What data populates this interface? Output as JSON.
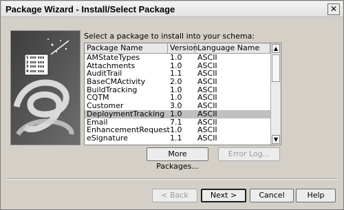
{
  "window": {
    "title": "Package Wizard - Install/Select Package",
    "close_label": "✕"
  },
  "prompt": "Select a package to install into your schema:",
  "list": {
    "columns": [
      "Package Name",
      "Version",
      "Language Name"
    ],
    "rows": [
      [
        "AMStateTypes",
        "1.0",
        "ASCII"
      ],
      [
        "Attachments",
        "1.0",
        "ASCII"
      ],
      [
        "AuditTrail",
        "1.1",
        "ASCII"
      ],
      [
        "BaseCMActivity",
        "2.0",
        "ASCII"
      ],
      [
        "BuildTracking",
        "1.0",
        "ASCII"
      ],
      [
        "CQTM",
        "1.0",
        "ASCII"
      ],
      [
        "Customer",
        "3.0",
        "ASCII"
      ],
      [
        "DeploymentTracking",
        "1.0",
        "ASCII"
      ],
      [
        "Email",
        "7.1",
        "ASCII"
      ],
      [
        "EnhancementRequest",
        "1.0",
        "ASCII"
      ],
      [
        "eSignature",
        "1.1",
        "ASCII"
      ]
    ],
    "selected_row": "DeploymentTracking"
  },
  "buttons": {
    "more_packages": "More Packages...",
    "error_log": "Error Log...",
    "back": "< Back",
    "next": "Next >",
    "cancel": "Cancel",
    "help": "Help"
  },
  "illustration": {
    "list_items": [
      "1 xxx xxx",
      "2 xxx xxx",
      "3 xxx xxx",
      "4 xxx xxx"
    ]
  }
}
